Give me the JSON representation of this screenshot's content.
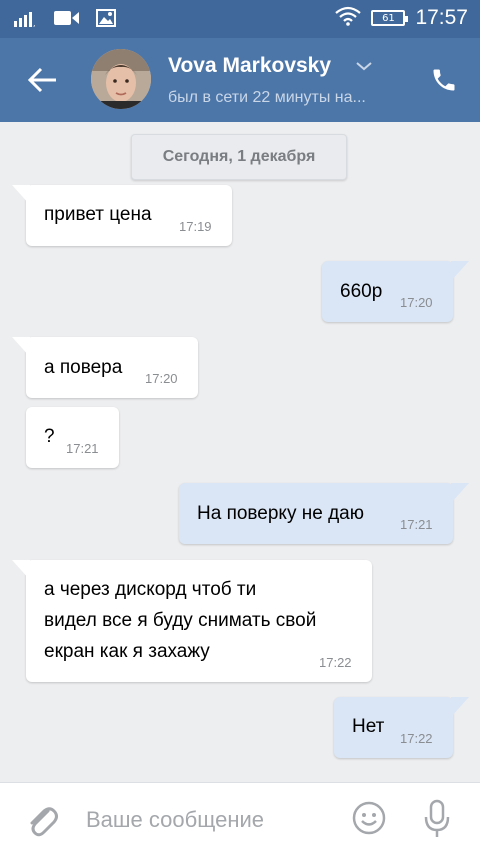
{
  "status_bar": {
    "time": "17:57",
    "battery": "61",
    "icons": [
      "signal-icon",
      "video-icon",
      "image-icon",
      "wifi-icon",
      "battery-icon"
    ]
  },
  "header": {
    "name": "Vova Markovsky",
    "status": "был в сети 22 минуты на...",
    "icons": [
      "back-arrow-icon",
      "chevron-down-icon",
      "phone-icon"
    ]
  },
  "date_label": "Сегодня, 1 декабря",
  "messages": [
    {
      "dir": "in",
      "text": "привет цена",
      "time": "17:19"
    },
    {
      "dir": "out",
      "text": "660р",
      "time": "17:20"
    },
    {
      "dir": "in",
      "text": "а повера",
      "time": "17:20"
    },
    {
      "dir": "in",
      "text": "?",
      "time": "17:21"
    },
    {
      "dir": "out",
      "text": "На поверку не даю",
      "time": "17:21"
    },
    {
      "dir": "in",
      "text": "а через дискорд чтоб ти\nвидел все я буду снимать свой\nекран как я захажу",
      "time": "17:22"
    },
    {
      "dir": "out",
      "text": "Нет",
      "time": "17:22"
    }
  ],
  "input": {
    "placeholder": "Ваше сообщение",
    "icons": [
      "paperclip-icon",
      "smile-icon",
      "microphone-icon"
    ]
  },
  "colors": {
    "header": "#4d76a8",
    "status_bar": "#41689a",
    "background": "#edeef0",
    "incoming_bubble": "#ffffff",
    "outgoing_bubble": "#dae6f5"
  }
}
